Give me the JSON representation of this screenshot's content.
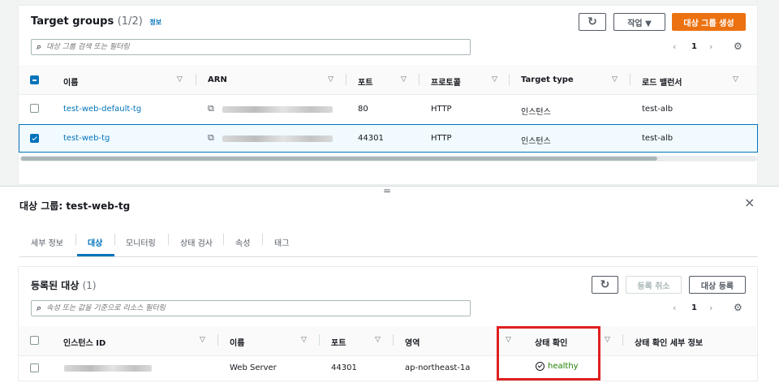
{
  "top": {
    "title": "Target groups",
    "count": "(1/2)",
    "info": "정보",
    "actions_label": "작업 ▼",
    "create_label": "대상 그룹 생성",
    "search_placeholder": "대상 그룹 검색 또는 필터링",
    "page": "1",
    "columns": [
      "이름",
      "ARN",
      "포트",
      "프로토콜",
      "Target type",
      "로드 밸런서"
    ],
    "rows": [
      {
        "name": "test-web-default-tg",
        "port": "80",
        "protocol": "HTTP",
        "type": "인스턴스",
        "lb": "test-alb",
        "checked": false
      },
      {
        "name": "test-web-tg",
        "port": "44301",
        "protocol": "HTTP",
        "type": "인스턴스",
        "lb": "test-alb",
        "checked": true
      }
    ]
  },
  "splitter_glyph": "=",
  "detail": {
    "title": "대상 그룹: test-web-tg",
    "close": "×",
    "tabs": [
      "세부 정보",
      "대상",
      "모니터링",
      "상태 검사",
      "속성",
      "태그"
    ],
    "active_tab": 1
  },
  "registered": {
    "title": "등록된 대상",
    "count": "(1)",
    "deregister_label": "등록 취소",
    "register_label": "대상 등록",
    "search_placeholder": "속성 또는 값을 기준으로 리소스 필터링",
    "page": "1",
    "columns": [
      "인스턴스 ID",
      "이름",
      "포트",
      "영역",
      "상태 확인",
      "상태 확인 세부 정보"
    ],
    "rows": [
      {
        "name": "Web Server",
        "port": "44301",
        "zone": "ap-northeast-1a",
        "health": "healthy"
      }
    ]
  },
  "colors": {
    "accent": "#ec7211",
    "link": "#0073bb",
    "healthy": "#1d8102",
    "highlight": "#e02020"
  }
}
